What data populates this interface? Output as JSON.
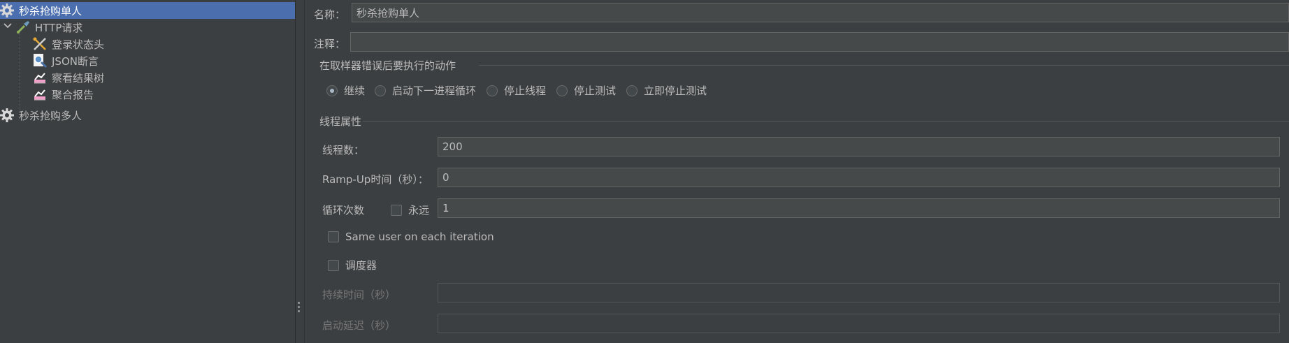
{
  "tree": {
    "items": [
      {
        "label": "秒杀抢购单人",
        "icon": "gear-icon"
      },
      {
        "label": "HTTP请求",
        "icon": "pipette-icon"
      },
      {
        "label": "登录状态头",
        "icon": "tools-icon"
      },
      {
        "label": "JSON断言",
        "icon": "magnifier-icon"
      },
      {
        "label": "察看结果树",
        "icon": "listener-chart-icon"
      },
      {
        "label": "聚合报告",
        "icon": "listener-chart-icon"
      },
      {
        "label": "秒杀抢购多人",
        "icon": "gear-icon"
      }
    ]
  },
  "form": {
    "name_label": "名称：",
    "name_value": "秒杀抢购单人",
    "comment_label": "注释：",
    "comment_value": "",
    "error_group_title": "在取样器错误后要执行的动作",
    "error_actions": [
      {
        "label": "继续",
        "selected": true
      },
      {
        "label": "启动下一进程循环",
        "selected": false
      },
      {
        "label": "停止线程",
        "selected": false
      },
      {
        "label": "停止测试",
        "selected": false
      },
      {
        "label": "立即停止测试",
        "selected": false
      }
    ],
    "thread_group_title": "线程属性",
    "threads_label": "线程数：",
    "threads_value": "200",
    "rampup_label": "Ramp-Up时间（秒）：",
    "rampup_value": "0",
    "loop_label": "循环次数",
    "forever_label": "永远",
    "loop_value": "1",
    "same_user_label": "Same user on each iteration",
    "scheduler_label": "调度器",
    "duration_label": "持续时间（秒）",
    "duration_value": "",
    "delay_label": "启动延迟（秒）",
    "delay_value": ""
  },
  "colors": {
    "background": "#3c3f41",
    "selection": "#4b6eaf",
    "field": "#45494a",
    "text": "#bbbbbb"
  }
}
